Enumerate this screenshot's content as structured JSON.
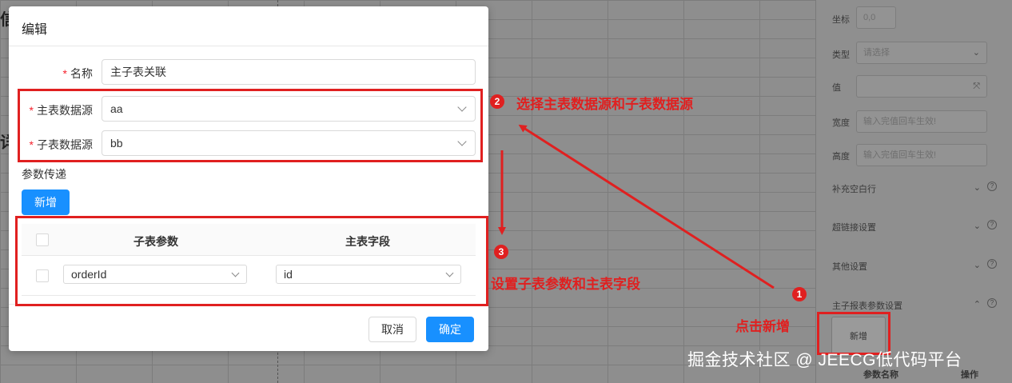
{
  "modal": {
    "title": "编辑",
    "required_mark": "*",
    "name_label": "名称",
    "name_value": "主子表关联",
    "main_source_label": "主表数据源",
    "main_source_value": "aa",
    "child_source_label": "子表数据源",
    "child_source_value": "bb",
    "param_label": "参数传递",
    "add_label": "新增",
    "table": {
      "columns": [
        "子表参数",
        "主表字段"
      ],
      "rows": [
        {
          "child_param": "orderId",
          "main_field": "id"
        }
      ]
    },
    "cancel_label": "取消",
    "ok_label": "确定"
  },
  "panel": {
    "coord_label": "坐标",
    "coord_value": "0,0",
    "type_label": "类型",
    "type_placeholder": "请选择",
    "value_label": "值",
    "width_label": "宽度",
    "width_placeholder": "输入完值回车生效!",
    "height_label": "高度",
    "height_placeholder": "输入完值回车生效!",
    "sections": [
      "补充空白行",
      "超链接设置",
      "其他设置",
      "主子报表参数设置"
    ],
    "add_label": "新增",
    "col_param": "参数名称",
    "col_action": "操作"
  },
  "annotations": {
    "badge1": "1",
    "badge2": "2",
    "badge3": "3",
    "step1": "点击新增",
    "step2": "选择主表数据源和子表数据源",
    "step3": "设置子表参数和主表字段"
  },
  "watermark": "掘金技术社区 @ JEECG低代码平台",
  "colors": {
    "primary": "#1890ff",
    "annotation_red": "#e02020",
    "required": "#f5222d"
  }
}
